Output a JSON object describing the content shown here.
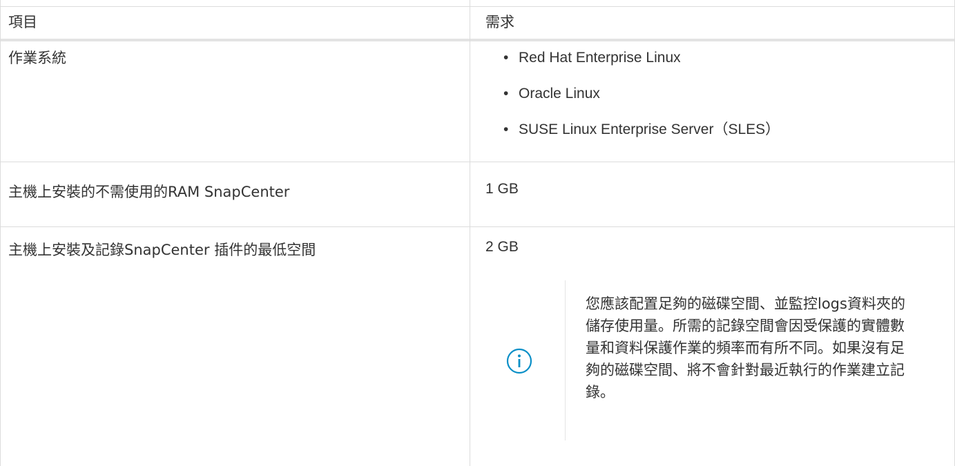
{
  "table": {
    "headers": [
      "項目",
      "需求"
    ],
    "rows": [
      {
        "item": "作業系統",
        "requirements": [
          "Red Hat Enterprise Linux",
          "Oracle Linux",
          "SUSE Linux Enterprise Server（SLES）"
        ]
      },
      {
        "item": "主機上安裝的不需使用的RAM SnapCenter",
        "requirement": "1 GB"
      },
      {
        "item": "主機上安裝及記錄SnapCenter 插件的最低空間",
        "requirement": "2 GB",
        "note": {
          "icon": "info-circle-icon",
          "text": "您應該配置足夠的磁碟空間、並監控logs資料夾的儲存使用量。所需的記錄空間會因受保護的實體數量和資料保護作業的頻率而有所不同。如果沒有足夠的磁碟空間、將不會針對最近執行的作業建立記錄。"
        }
      }
    ]
  },
  "colors": {
    "border": "#dcdcdc",
    "text": "#333333",
    "info_icon": "#0a8fc7"
  }
}
